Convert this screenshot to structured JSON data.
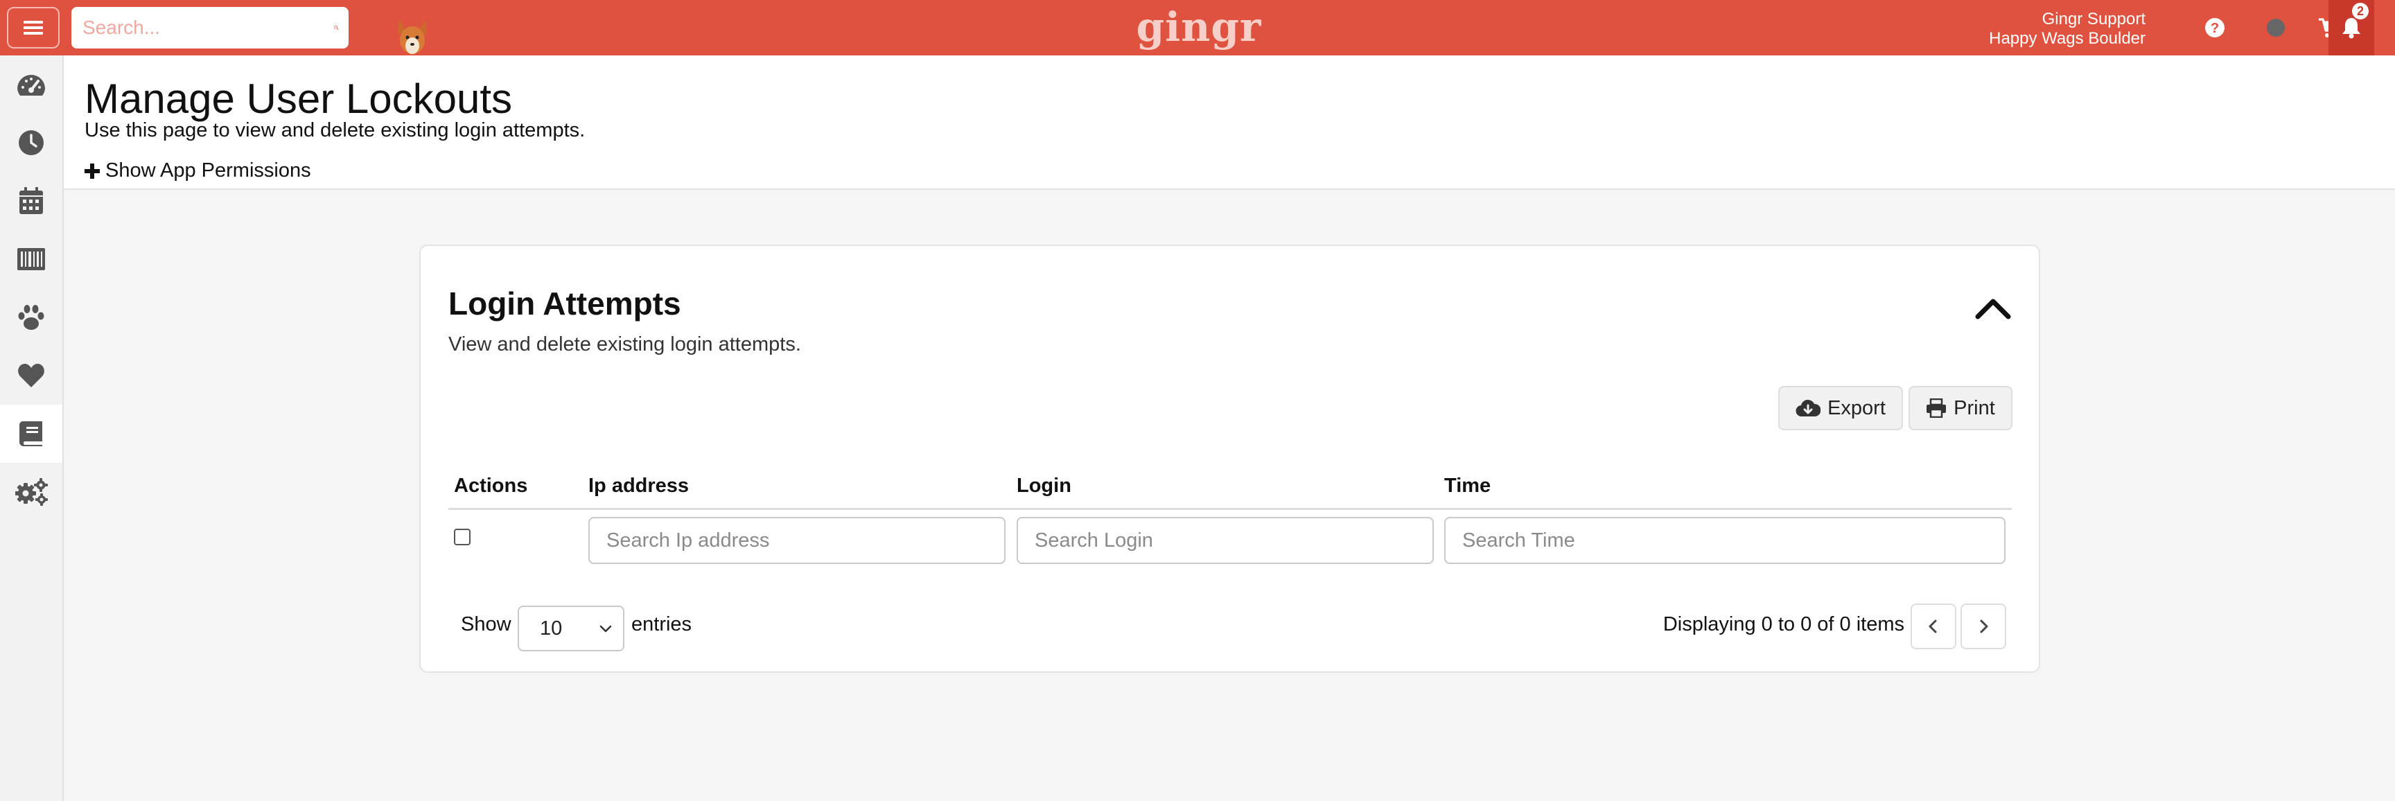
{
  "topbar": {
    "search_placeholder": "Search...",
    "logo_text": "gingr",
    "user_name": "Gingr Support",
    "location": "Happy Wags Boulder",
    "notification_count": "2",
    "accent_color": "#e05240"
  },
  "sidebar": {
    "items": [
      {
        "icon": "dashboard-gauge-icon"
      },
      {
        "icon": "clock-icon"
      },
      {
        "icon": "calendar-icon"
      },
      {
        "icon": "barcode-icon"
      },
      {
        "icon": "paw-icon"
      },
      {
        "icon": "heart-icon"
      },
      {
        "icon": "book-icon",
        "active": true
      },
      {
        "icon": "gears-icon"
      }
    ]
  },
  "header": {
    "title": "Manage User Lockouts",
    "subtitle": "Use this page to view and delete existing login attempts.",
    "show_permissions": "Show App Permissions"
  },
  "card": {
    "title": "Login Attempts",
    "subtitle": "View and delete existing login attempts.",
    "export_label": "Export",
    "print_label": "Print",
    "columns": [
      "Actions",
      "Ip address",
      "Login",
      "Time"
    ],
    "placeholders": {
      "ip": "Search Ip address",
      "login": "Search Login",
      "time": "Search Time"
    },
    "show_label": "Show",
    "entries_value": "10",
    "entries_label": "entries",
    "displaying": "Displaying 0 to 0 of 0 items"
  }
}
